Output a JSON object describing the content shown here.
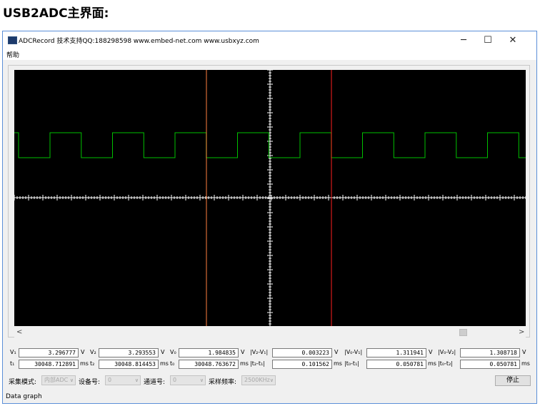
{
  "page": {
    "heading": "USB2ADC主界面:"
  },
  "window": {
    "title": "ADCRecord 技术支持QQ:188298598 www.embed-net.com www.usbxyz.com",
    "minimize_glyph": "─",
    "maximize_glyph": "☐",
    "close_glyph": "✕"
  },
  "menu": {
    "items": [
      "帮助"
    ]
  },
  "plot": {
    "background": "#000000",
    "axis_color": "#ffffff",
    "signal_color": "#00c000",
    "cursor1_color": "#ff8040",
    "cursor2_color": "#ff2020",
    "signal": "square wave"
  },
  "scrollbar": {
    "left_arrow": "<",
    "right_arrow": ">",
    "position": 0.87
  },
  "measurements": {
    "row1": [
      {
        "label": "V₁",
        "value": "3.296777",
        "unit": "V"
      },
      {
        "label": "V₂",
        "value": "3.293553",
        "unit": "V"
      },
      {
        "label": "V₀",
        "value": "1.984835",
        "unit": "V"
      },
      {
        "label": "|V₂-V₁|",
        "value": "0.003223",
        "unit": "V"
      },
      {
        "label": "|V₀-V₁|",
        "value": "1.311941",
        "unit": "V"
      },
      {
        "label": "|V₀-V₂|",
        "value": "1.308718",
        "unit": "V"
      }
    ],
    "row2": [
      {
        "label": "t₁",
        "value": "30048.712891",
        "unit": "ms"
      },
      {
        "label": "t₂",
        "value": "30048.814453",
        "unit": "ms"
      },
      {
        "label": "t₀",
        "value": "30048.763672",
        "unit": "ms"
      },
      {
        "label": "|t₂-t₁|",
        "value": "0.101562",
        "unit": "ms"
      },
      {
        "label": "|t₀-t₁|",
        "value": "0.050781",
        "unit": "ms"
      },
      {
        "label": "|t₀-t₂|",
        "value": "0.050781",
        "unit": "ms"
      }
    ]
  },
  "controls": {
    "mode_label": "采集模式:",
    "mode_value": "内部ADC",
    "device_label": "设备号:",
    "device_value": "0",
    "channel_label": "通道号:",
    "channel_value": "0",
    "rate_label": "采样频率:",
    "rate_value": "2500KHz",
    "dropdown_glyph": "∨",
    "stop_label": "停止"
  },
  "status": {
    "text": "Data graph"
  }
}
